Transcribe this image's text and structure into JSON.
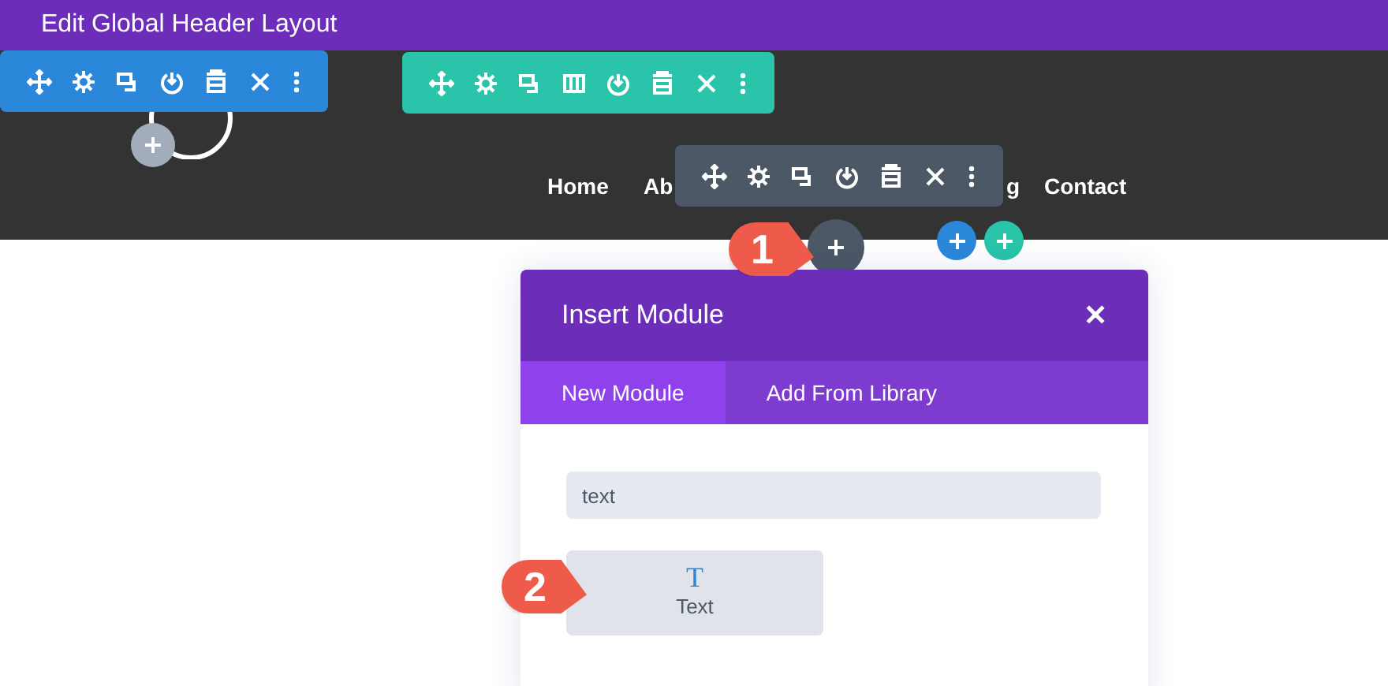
{
  "window": {
    "title": "Edit Global Header Layout"
  },
  "toolbars": [
    {
      "kind": "section",
      "icons": [
        {
          "kind": "move"
        },
        {
          "kind": "settings"
        },
        {
          "kind": "duplicate"
        },
        {
          "kind": "save"
        },
        {
          "kind": "delete"
        },
        {
          "kind": "close"
        },
        {
          "kind": "more"
        }
      ]
    },
    {
      "kind": "row",
      "icons": [
        {
          "kind": "move"
        },
        {
          "kind": "settings"
        },
        {
          "kind": "duplicate"
        },
        {
          "kind": "columns"
        },
        {
          "kind": "save"
        },
        {
          "kind": "delete"
        },
        {
          "kind": "close"
        },
        {
          "kind": "more"
        }
      ]
    },
    {
      "kind": "module",
      "icons": [
        {
          "kind": "move"
        },
        {
          "kind": "settings"
        },
        {
          "kind": "duplicate"
        },
        {
          "kind": "save"
        },
        {
          "kind": "delete"
        },
        {
          "kind": "close"
        },
        {
          "kind": "more"
        }
      ]
    }
  ],
  "nav": {
    "items": [
      {
        "label": "Home"
      },
      {
        "label": "Ab"
      },
      {
        "label": "g"
      },
      {
        "label": "Contact"
      }
    ]
  },
  "callouts": [
    {
      "label": "1"
    },
    {
      "label": "2"
    }
  ],
  "modal": {
    "title": "Insert Module",
    "close": "✕",
    "tabs": [
      {
        "label": "New Module",
        "selected": true
      },
      {
        "label": "Add From Library",
        "selected": false
      }
    ],
    "search": {
      "value": "text"
    },
    "modules": [
      {
        "icon": "T",
        "label": "Text"
      }
    ]
  }
}
